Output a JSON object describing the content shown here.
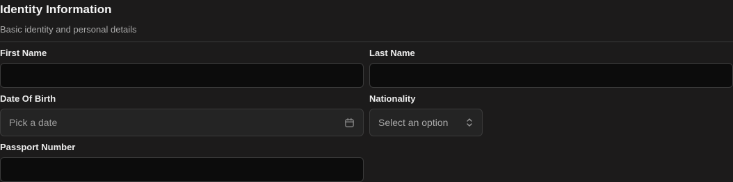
{
  "section": {
    "title": "Identity Information",
    "subtitle": "Basic identity and personal details"
  },
  "fields": {
    "first_name": {
      "label": "First Name",
      "value": ""
    },
    "last_name": {
      "label": "Last Name",
      "value": ""
    },
    "date_of_birth": {
      "label": "Date Of Birth",
      "placeholder": "Pick a date",
      "icon": "calendar-icon"
    },
    "nationality": {
      "label": "Nationality",
      "placeholder": "Select an option",
      "icon": "chevron-up-down-icon"
    },
    "passport_number": {
      "label": "Passport Number",
      "value": ""
    }
  },
  "colors": {
    "background": "#1c1b1b",
    "input_background": "#0c0c0c",
    "picker_background": "#242424",
    "border": "#3b3b3b"
  }
}
